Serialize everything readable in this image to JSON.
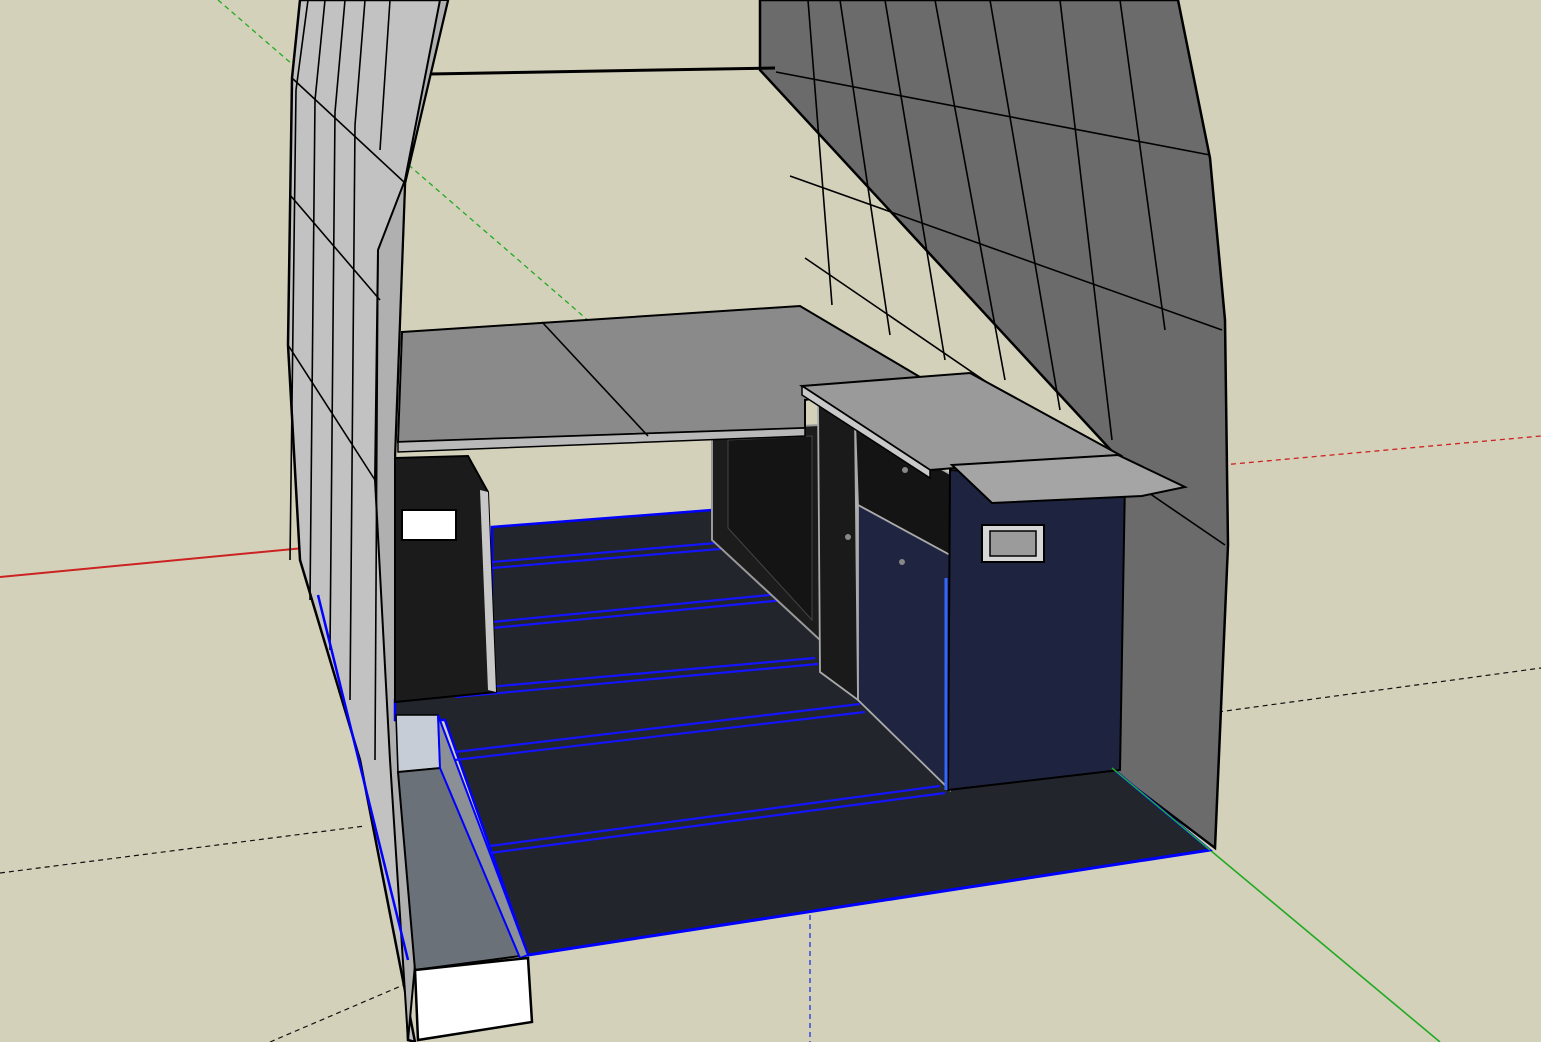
{
  "app": {
    "viewport": "3d-modeling-canvas",
    "background": "#d4d1bb"
  },
  "colors": {
    "axis_red": "#cc2a2a",
    "axis_green": "#2aa52a",
    "axis_blue": "#2a2acc",
    "axis_dashed_black": "#1a1a1a",
    "wall_light": "#b4b4b4",
    "wall_dark": "#6a6a6a",
    "floor": "#20232a",
    "floor_strip": "#1717ff",
    "cabinet": "#1b1b1b",
    "cabinet_panel_blue": "#1e2540",
    "countertop": "#8f8f8f",
    "selection_edge": "#0000ff",
    "white_box": "#ffffff",
    "light_blue_box": "#c3cbd4",
    "grey_box": "#6d7479"
  },
  "scene": {
    "objects": [
      {
        "name": "van-left-wall",
        "interactable": true
      },
      {
        "name": "van-right-wall",
        "interactable": true
      },
      {
        "name": "bed-platform",
        "interactable": true
      },
      {
        "name": "fridge-cabinet",
        "interactable": true
      },
      {
        "name": "kitchen-cabinet",
        "interactable": true
      },
      {
        "name": "kitchen-countertop",
        "interactable": true
      },
      {
        "name": "floor",
        "interactable": true
      },
      {
        "name": "wheel-well-box",
        "interactable": true
      }
    ]
  }
}
